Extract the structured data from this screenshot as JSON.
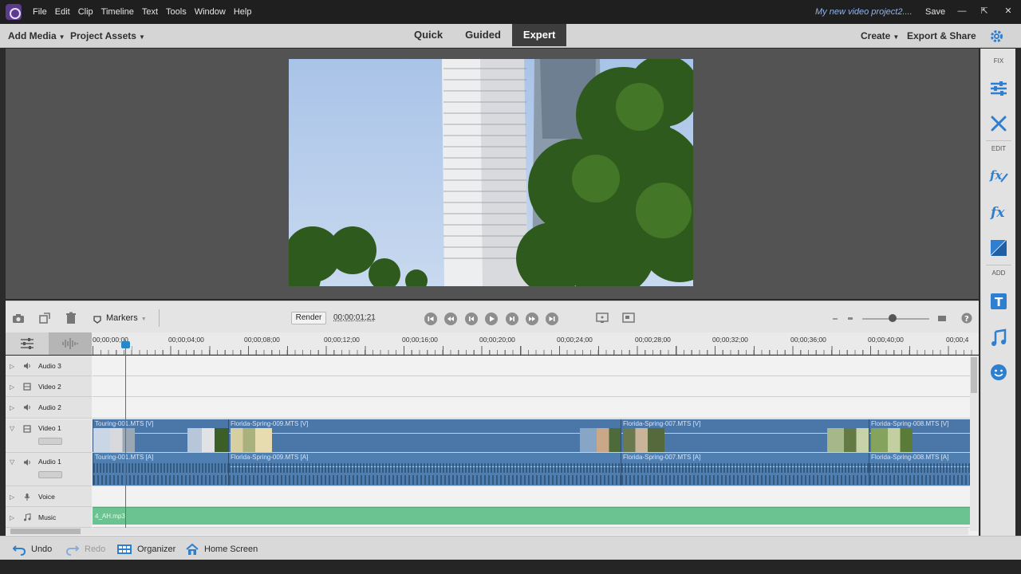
{
  "menubar": {
    "items": [
      "File",
      "Edit",
      "Clip",
      "Timeline",
      "Text",
      "Tools",
      "Window",
      "Help"
    ],
    "project_name": "My new video project2....",
    "save_label": "Save"
  },
  "modebar": {
    "add_media": "Add Media",
    "project_assets": "Project Assets",
    "tabs": [
      {
        "label": "Quick",
        "active": false
      },
      {
        "label": "Guided",
        "active": false
      },
      {
        "label": "Expert",
        "active": true
      }
    ],
    "create": "Create",
    "export_share": "Export & Share"
  },
  "right_panel": {
    "fix_label": "FIX",
    "edit_label": "EDIT",
    "add_label": "ADD",
    "icons": [
      "adjust-icon",
      "tools-icon",
      "applied-effects-icon",
      "effects-icon",
      "transitions-icon",
      "titles-icon",
      "music-icon",
      "graphics-icon"
    ]
  },
  "timeline_toolbar": {
    "markers_label": "Markers",
    "render_label": "Render",
    "timecode": "00;00;01;21"
  },
  "ruler": {
    "labels": [
      "00;00;00;00",
      "00;00;04;00",
      "00;00;08;00",
      "00;00;12;00",
      "00;00;16;00",
      "00;00;20;00",
      "00;00;24;00",
      "00;00;28;00",
      "00;00;32;00",
      "00;00;36;00",
      "00;00;40;00",
      "00;00;4"
    ]
  },
  "tracks": [
    {
      "name": "Audio 3"
    },
    {
      "name": "Video 2"
    },
    {
      "name": "Audio 2"
    },
    {
      "name": "Video 1"
    },
    {
      "name": "Audio 1"
    },
    {
      "name": "Voice"
    },
    {
      "name": "Music"
    }
  ],
  "clips": {
    "video": [
      "Touring-001.MTS [V]",
      "Florida-Spring-009.MTS [V]",
      "Florida-Spring-007.MTS [V]",
      "Florida-Spring-008.MTS [V]"
    ],
    "audio": [
      "Touring-001.MTS [A]",
      "Florida-Spring-009.MTS [A]",
      "Florida-Spring-007.MTS [A]",
      "Florida-Spring-008.MTS [A]"
    ],
    "music": "4_AH.mp3"
  },
  "bottombar": {
    "undo": "Undo",
    "redo": "Redo",
    "organizer": "Organizer",
    "home_screen": "Home Screen"
  }
}
